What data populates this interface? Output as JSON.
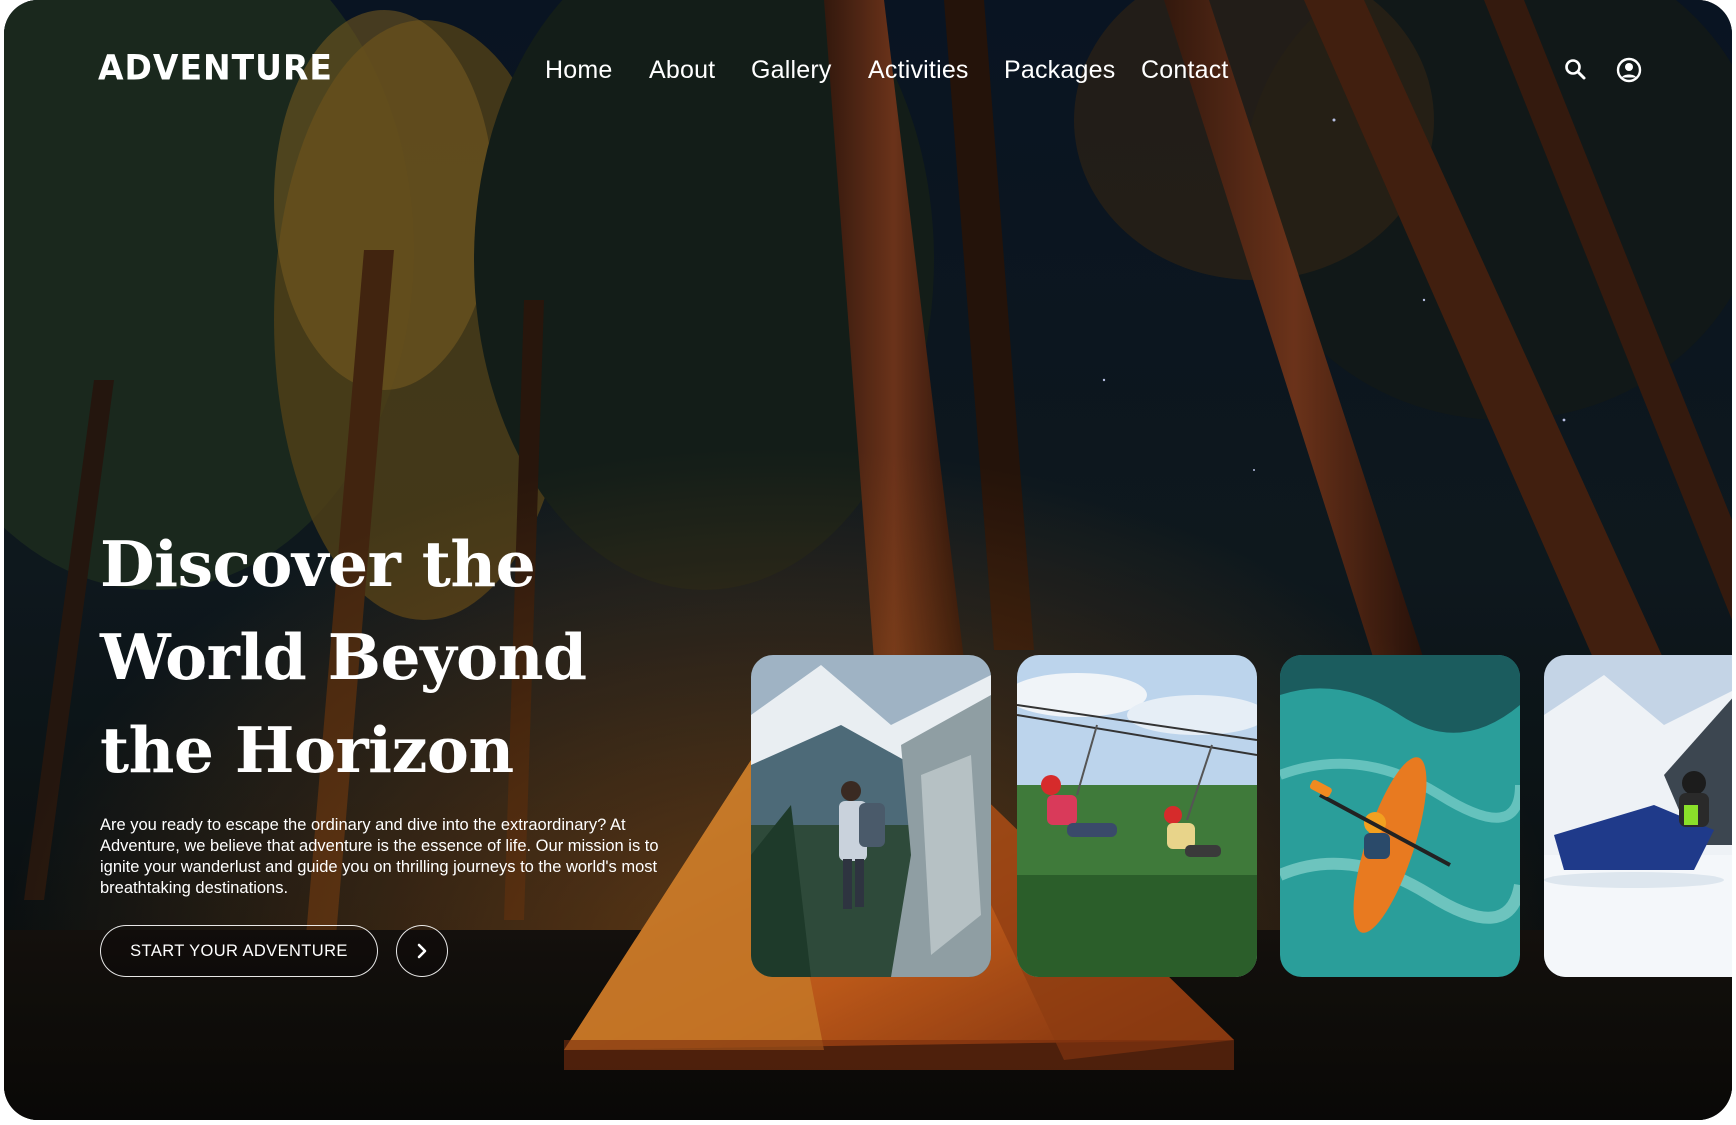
{
  "brand": {
    "logo_text": "ADVENTURE"
  },
  "nav": {
    "items": [
      {
        "label": "Home"
      },
      {
        "label": "About"
      },
      {
        "label": "Gallery"
      },
      {
        "label": "Activities"
      },
      {
        "label": "Packages"
      },
      {
        "label": "Contact"
      }
    ]
  },
  "header_icons": {
    "search": "search-icon",
    "account": "user-account-icon"
  },
  "hero": {
    "title_line1": "Discover the",
    "title_line2": "World Beyond",
    "title_line3": "the Horizon",
    "description": "Are you ready to escape the ordinary and dive into the extraordinary? At Adventure, we believe that adventure is the essence of life. Our mission is to ignite your wanderlust and guide you on thrilling journeys to the world's most breathtaking destinations.",
    "cta_label": "START YOUR ADVENTURE",
    "cta_arrow_icon": "chevron-right-icon"
  },
  "cards": [
    {
      "activity": "hiking"
    },
    {
      "activity": "zipline"
    },
    {
      "activity": "kayaking"
    },
    {
      "activity": "snowmobile"
    }
  ],
  "colors": {
    "text": "#ffffff",
    "tent": "#d9782a",
    "forest": "#1d2a22",
    "sky": "#0c1a2c"
  }
}
